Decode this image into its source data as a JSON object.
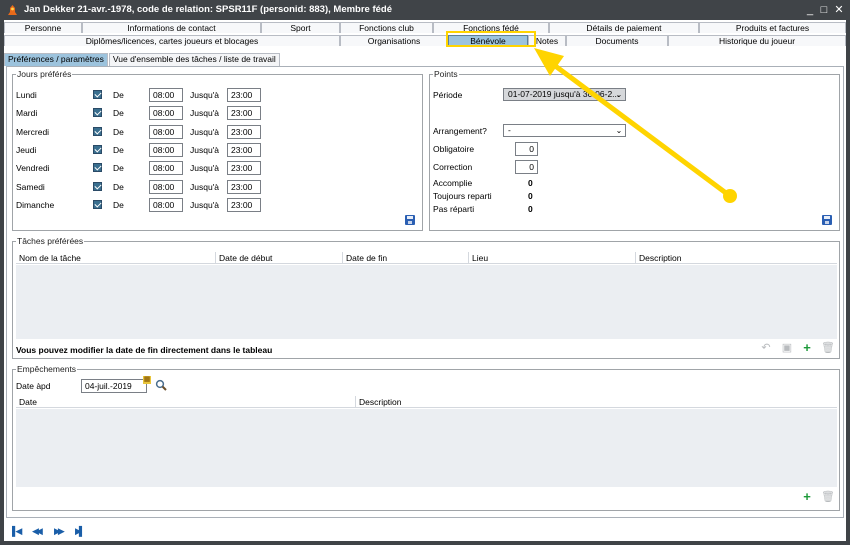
{
  "window": {
    "title": "Jan Dekker 21-avr.-1978, code de relation: SPSR11F (personid: 883), Membre fédé",
    "minimize": "_",
    "maximize": "□",
    "close": "✕"
  },
  "tabs_row1": [
    "Personne",
    "Informations de contact",
    "Sport",
    "Fonctions club",
    "Fonctions fédé",
    "Détails de paiement",
    "Produits et factures"
  ],
  "tabs_row2": [
    "Diplômes/licences, cartes joueurs et blocages",
    "Organisations",
    "Bénévole",
    "Notes",
    "Documents",
    "Historique du joueur"
  ],
  "subtabs": [
    "Préférences / paramètres",
    "Vue d'ensemble des tâches / liste de travail"
  ],
  "jours": {
    "title": "Jours préférés",
    "from_label": "De",
    "to_label": "Jusqu'à",
    "days": [
      {
        "name": "Lundi",
        "checked": true,
        "from": "08:00",
        "to": "23:00"
      },
      {
        "name": "Mardi",
        "checked": true,
        "from": "08:00",
        "to": "23:00"
      },
      {
        "name": "Mercredi",
        "checked": true,
        "from": "08:00",
        "to": "23:00"
      },
      {
        "name": "Jeudi",
        "checked": true,
        "from": "08:00",
        "to": "23:00"
      },
      {
        "name": "Vendredi",
        "checked": true,
        "from": "08:00",
        "to": "23:00"
      },
      {
        "name": "Samedi",
        "checked": true,
        "from": "08:00",
        "to": "23:00"
      },
      {
        "name": "Dimanche",
        "checked": true,
        "from": "08:00",
        "to": "23:00"
      }
    ]
  },
  "points": {
    "title": "Points",
    "periode_label": "Période",
    "periode_value": "01-07-2019 jusqu'à 30-06-2...",
    "arrangement_label": "Arrangement?",
    "arrangement_value": "-",
    "obligatoire_label": "Obligatoire",
    "obligatoire_value": "0",
    "correction_label": "Correction",
    "correction_value": "0",
    "accomplie_label": "Accomplie",
    "accomplie_value": "0",
    "toujours_label": "Toujours reparti",
    "toujours_value": "0",
    "pas_label": "Pas réparti",
    "pas_value": "0"
  },
  "taches": {
    "title": "Tâches préférées",
    "columns": [
      "Nom de la tâche",
      "Date de début",
      "Date de fin",
      "Lieu",
      "Description"
    ],
    "note": "Vous pouvez modifier la date de fin directement dans le tableau"
  },
  "empechements": {
    "title": "Empêchements",
    "date_label": "Date àpd",
    "date_value": "04-juil.-2019",
    "columns": [
      "Date",
      "Description"
    ]
  },
  "colors": {
    "accent": "#9cc3dd",
    "highlight": "#ffd400",
    "titlebar": "#404448"
  }
}
